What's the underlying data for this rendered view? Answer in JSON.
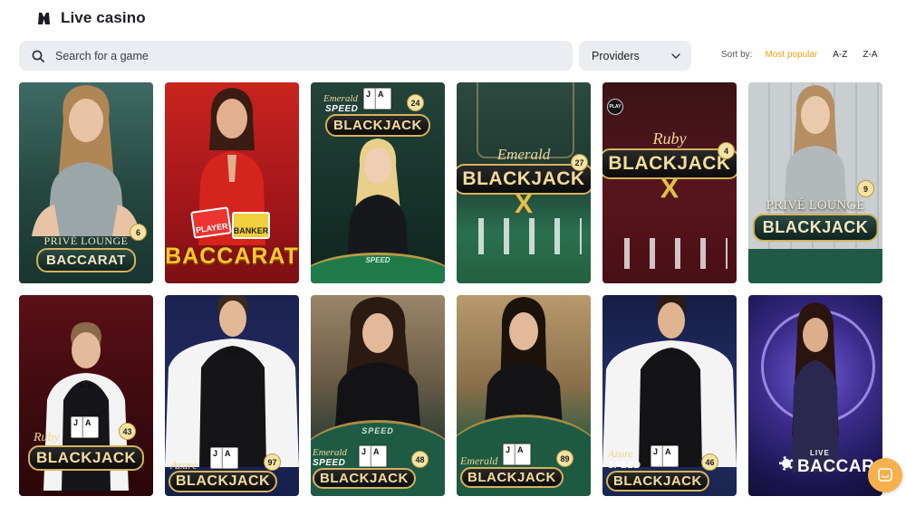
{
  "header": {
    "title": "Live casino",
    "icon": "vest-icon"
  },
  "search": {
    "placeholder": "Search for a game",
    "value": ""
  },
  "providers": {
    "label": "Providers"
  },
  "sort": {
    "label": "Sort by:",
    "options": [
      "Most popular",
      "A-Z",
      "Z-A"
    ],
    "active": "Most popular",
    "active_color": "#f2a20c"
  },
  "games": [
    {
      "top": "PRIVÉ LOUNGE",
      "name": "BACCARAT",
      "badge": "6"
    },
    {
      "name": "BACCARAT",
      "tags": [
        "PLAYER",
        "BANKER"
      ]
    },
    {
      "top": "Emerald",
      "speed": "SPEED",
      "name": "BLACKJACK",
      "badge": "24",
      "felt": "SPEED"
    },
    {
      "top": "Emerald",
      "name": "BLACKJACK",
      "sub": "X",
      "badge": "27"
    },
    {
      "top": "Ruby",
      "name": "BLACKJACK",
      "sub": "X",
      "badge": "4",
      "corner": "PLAY"
    },
    {
      "top": "PRIVÉ LOUNGE",
      "name": "BLACKJACK",
      "badge": "9"
    },
    {
      "top": "Ruby",
      "name": "BLACKJACK",
      "badge": "43"
    },
    {
      "top": "Azure",
      "name": "BLACKJACK",
      "badge": "97"
    },
    {
      "top": "Emerald",
      "speed": "SPEED",
      "name": "BLACKJACK",
      "badge": "48",
      "felt": "SPEED"
    },
    {
      "top": "Emerald",
      "name": "BLACKJACK",
      "badge": "89"
    },
    {
      "top": "Azure",
      "speed": "SPEED",
      "name": "BLACKJACK",
      "badge": "46"
    },
    {
      "top": "LIVE",
      "name": "BACCARAT"
    }
  ],
  "chat": {
    "icon": "chat-icon"
  }
}
